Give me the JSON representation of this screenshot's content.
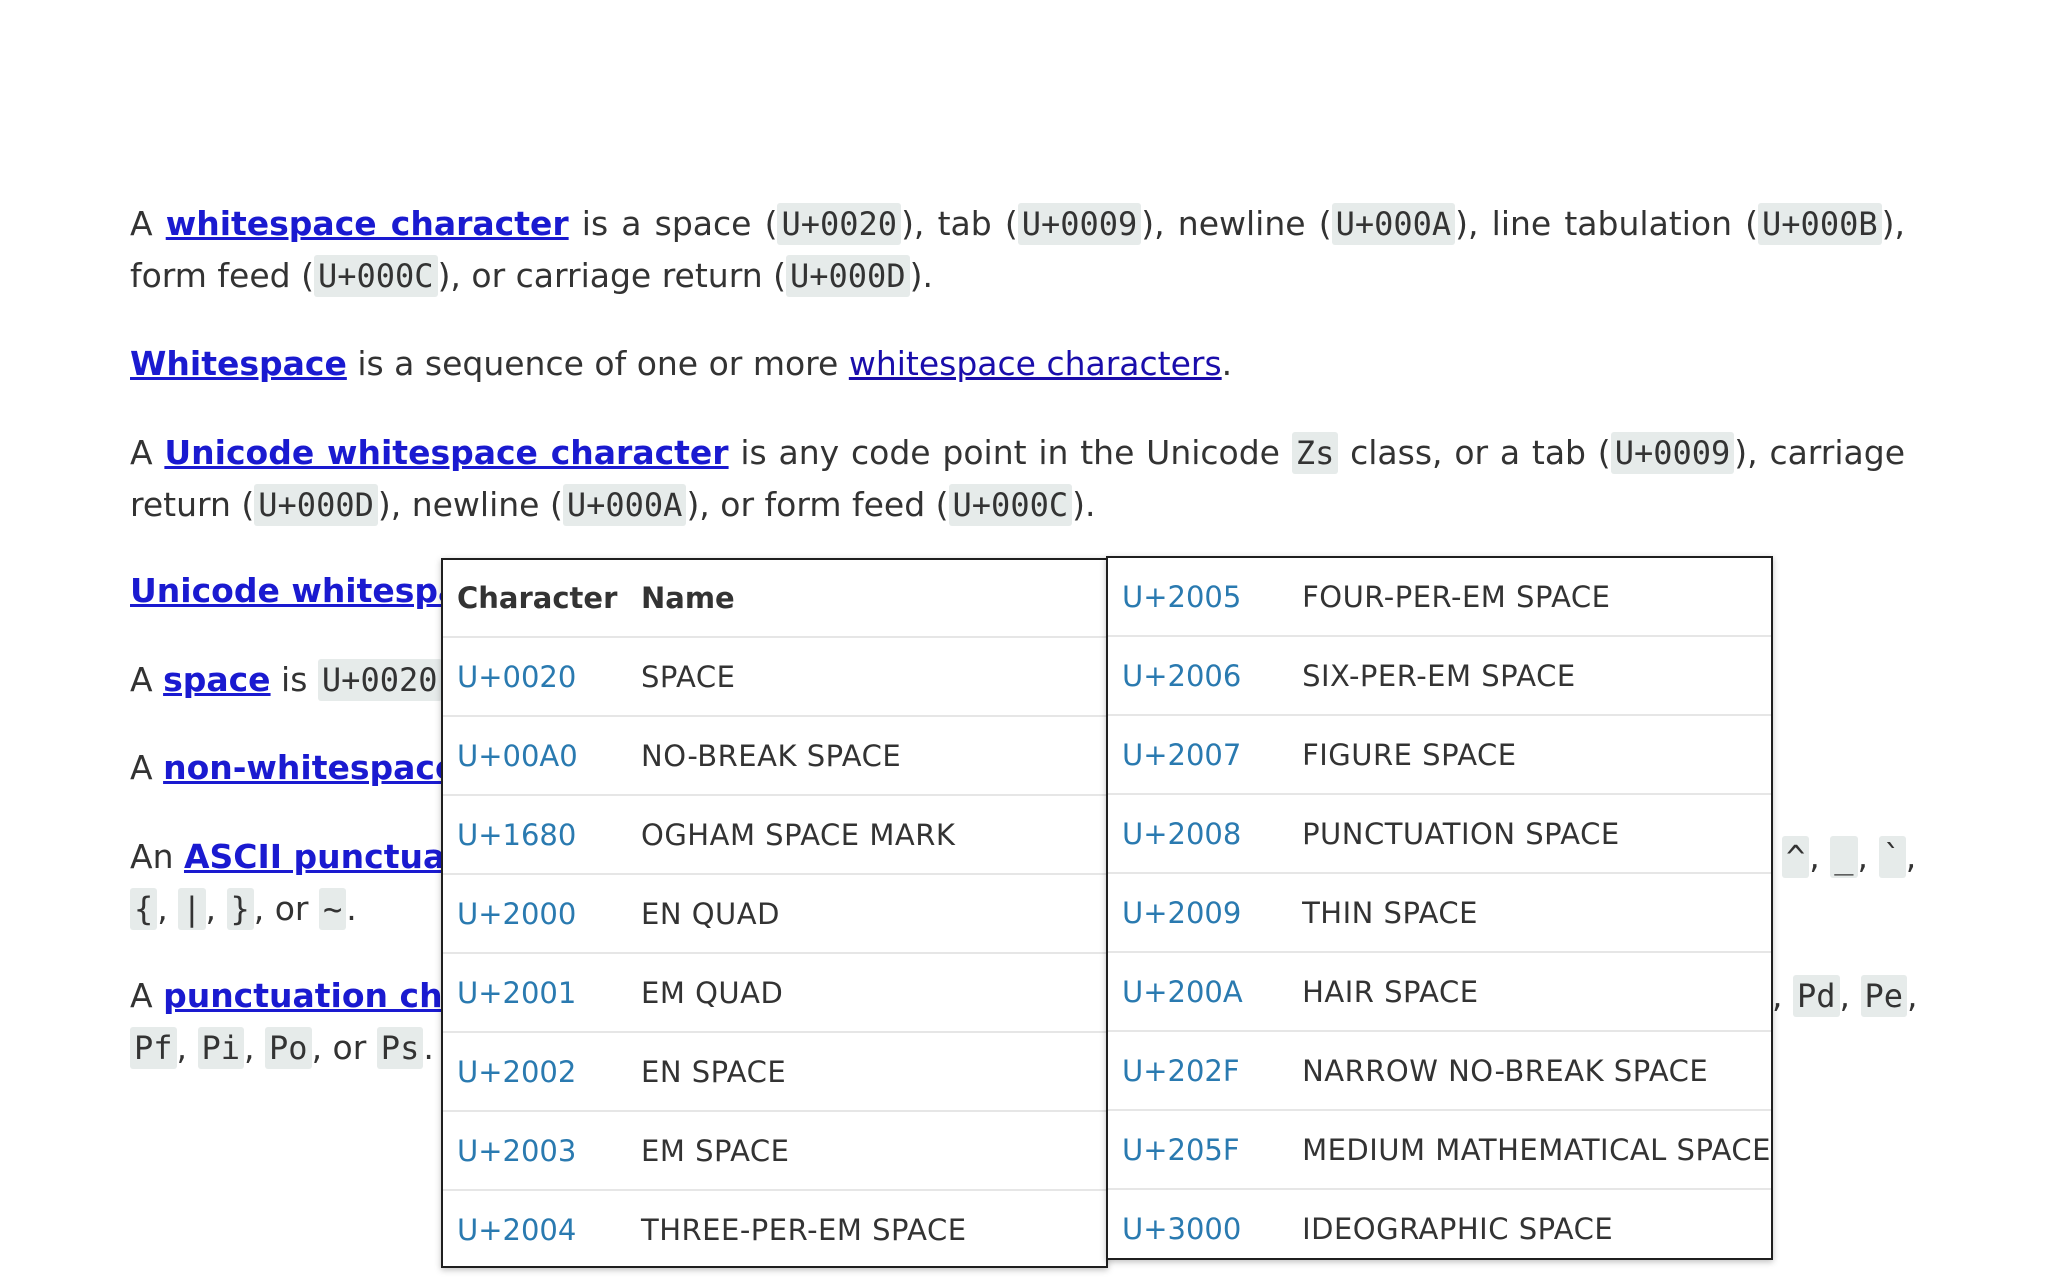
{
  "para1": {
    "a": "A ",
    "link": "whitespace character",
    "t1": " is a space (",
    "c1": "U+0020",
    "t2": "), tab (",
    "c2": "U+0009",
    "t3": "), newline (",
    "c3": "U+000A",
    "t4": "), line tabulation (",
    "c4": "U+000B",
    "t5": "), form feed (",
    "c5": "U+000C",
    "t6": "), or carriage return (",
    "c6": "U+000D",
    "t7": ")."
  },
  "para2": {
    "link1": "Whitespace",
    "t1": " is a sequence of one or more ",
    "link2": "whitespace characters",
    "t2": "."
  },
  "para3": {
    "a": "A ",
    "link": "Unicode whitespace character",
    "t1": " is any code point in the Unicode ",
    "c1": "Zs",
    "t2": " class, or a tab (",
    "c2": "U+0009",
    "t3": "), carriage return (",
    "c3": "U+000D",
    "t4": "), newline (",
    "c4": "U+000A",
    "t5": "), or form feed (",
    "c5": "U+000C",
    "t6": ")."
  },
  "para4": {
    "link": "Unicode whitespa"
  },
  "para5": {
    "a": "A ",
    "link": "space",
    "t1": " is ",
    "c1": "U+0020"
  },
  "para6": {
    "a": "A ",
    "link": "non-whitespace"
  },
  "para7": {
    "a": "An ",
    "link": "ASCII punctua",
    "r1": "^",
    "r2": "_",
    "r3": "`",
    "l1": "{",
    "l2": "|",
    "l3": "}",
    "lor": ", or ",
    "l4": "~"
  },
  "para8": {
    "a": "A ",
    "link": "punctuation cha",
    "r1": "Pd",
    "r2": "Pe",
    "l1": "Pf",
    "l2": "Pi",
    "l3": "Po",
    "lor": ", or ",
    "l4": "Ps"
  },
  "table_left": {
    "headers": [
      "Character",
      "Name"
    ],
    "rows": [
      [
        "U+0020",
        "SPACE"
      ],
      [
        "U+00A0",
        "NO-BREAK SPACE"
      ],
      [
        "U+1680",
        "OGHAM SPACE MARK"
      ],
      [
        "U+2000",
        "EN QUAD"
      ],
      [
        "U+2001",
        "EM QUAD"
      ],
      [
        "U+2002",
        "EN SPACE"
      ],
      [
        "U+2003",
        "EM SPACE"
      ],
      [
        "U+2004",
        "THREE-PER-EM SPACE"
      ]
    ]
  },
  "table_right": {
    "rows": [
      [
        "U+2005",
        "FOUR-PER-EM SPACE"
      ],
      [
        "U+2006",
        "SIX-PER-EM SPACE"
      ],
      [
        "U+2007",
        "FIGURE SPACE"
      ],
      [
        "U+2008",
        "PUNCTUATION SPACE"
      ],
      [
        "U+2009",
        "THIN SPACE"
      ],
      [
        "U+200A",
        "HAIR SPACE"
      ],
      [
        "U+202F",
        "NARROW NO-BREAK SPACE"
      ],
      [
        "U+205F",
        "MEDIUM MATHEMATICAL SPACE"
      ],
      [
        "U+3000",
        "IDEOGRAPHIC SPACE"
      ]
    ]
  },
  "colors": {
    "link": "#1a0dab",
    "code_bg": "#e6ebea",
    "table_code": "#2a7ab0"
  }
}
